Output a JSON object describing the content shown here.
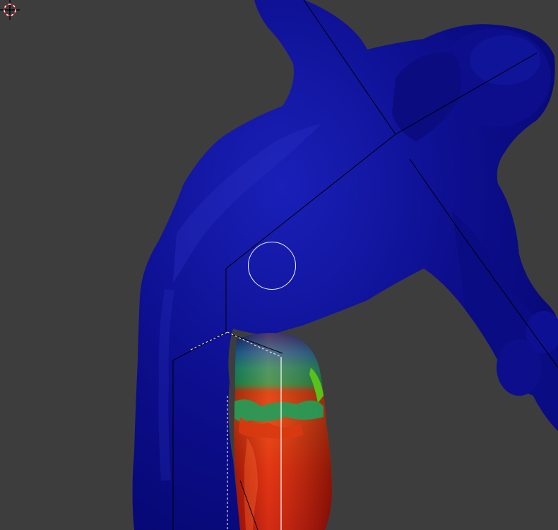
{
  "viewport": {
    "mode": "weight-paint",
    "background_color": "#3d3d3d",
    "mesh_zero_weight_color": "#0c0e8c",
    "mesh_full_weight_color": "#d8140a",
    "mid_weight_colors": [
      "#1a6fb0",
      "#1fa05a",
      "#59c21a"
    ],
    "bone_line_color": "#000000",
    "selection_line_color": "#ffffff"
  },
  "tools": {
    "brush_cursor": "circle-brush-cursor",
    "scene_cursor": "3d-cursor-crosshair"
  }
}
